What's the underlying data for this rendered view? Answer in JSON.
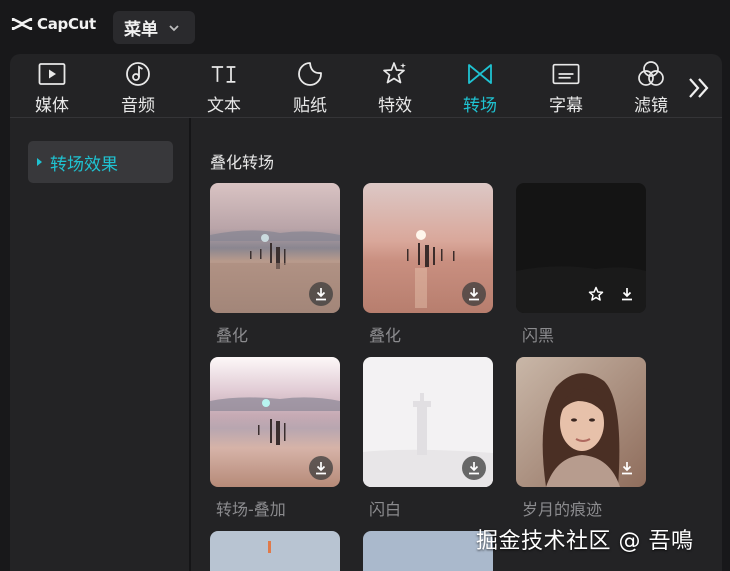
{
  "titlebar": {
    "app_name": "CapCut",
    "menu_label": "菜单"
  },
  "toolbar": {
    "tabs": [
      {
        "label": "媒体",
        "icon": "media-play-icon"
      },
      {
        "label": "音频",
        "icon": "audio-note-icon"
      },
      {
        "label": "文本",
        "icon": "text-ti-icon"
      },
      {
        "label": "贴纸",
        "icon": "sticker-icon"
      },
      {
        "label": "特效",
        "icon": "effects-star-icon"
      },
      {
        "label": "转场",
        "icon": "transition-bowtie-icon",
        "active": true
      },
      {
        "label": "字幕",
        "icon": "caption-icon"
      },
      {
        "label": "滤镜",
        "icon": "filter-circles-icon"
      }
    ],
    "more_icon": "double-chevron-right-icon",
    "accent_color": "#1fc2d1"
  },
  "sidebar": {
    "items": [
      {
        "label": "转场效果",
        "selected": true
      }
    ]
  },
  "content": {
    "section_title": "叠化转场",
    "cards": [
      {
        "label": "叠化",
        "status": "download"
      },
      {
        "label": "叠化",
        "status": "download"
      },
      {
        "label": "闪黑",
        "status": "favorite+download"
      },
      {
        "label": "转场-叠加",
        "status": "download"
      },
      {
        "label": "闪白",
        "status": "download"
      },
      {
        "label": "岁月的痕迹",
        "status": "download"
      }
    ]
  },
  "watermark": "掘金技术社区 @ 吾鳴"
}
